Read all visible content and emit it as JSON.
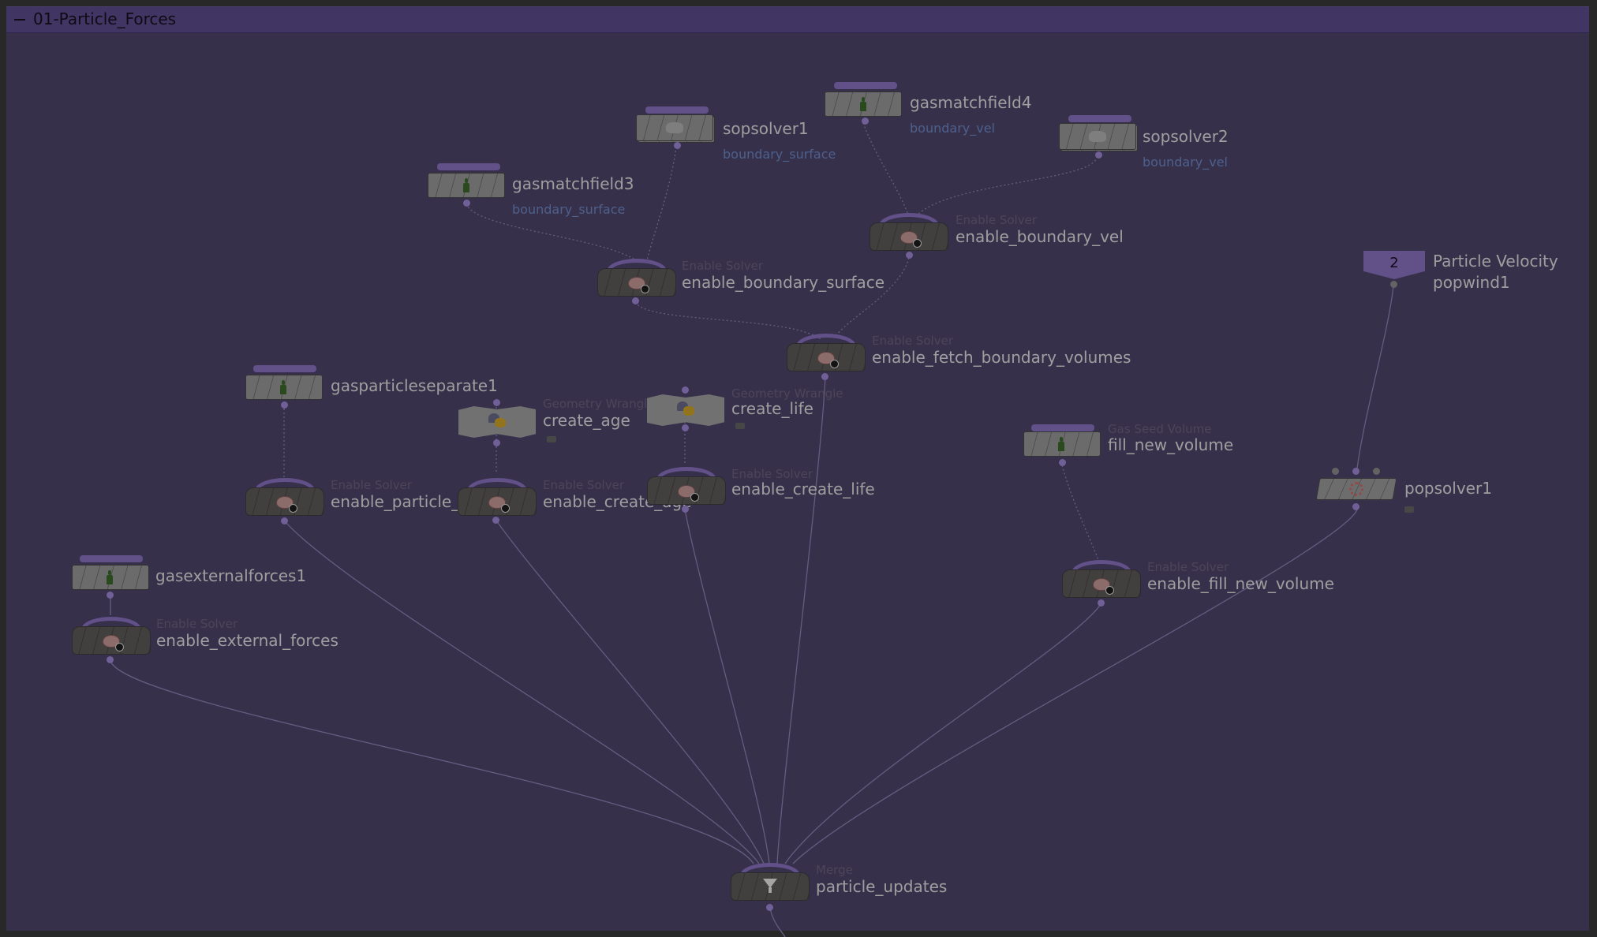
{
  "network_box": {
    "title": "01-Particle_Forces"
  },
  "colors": {
    "background": "#4f456c",
    "title_bar": "#5e4c90",
    "node_bar": "#8d73c4",
    "comment": "#6f8ac9"
  },
  "nodes": {
    "sopsolver1": {
      "name": "sopsolver1",
      "comment": "boundary_surface",
      "icon": "cloud-icon"
    },
    "gasmatchfield4": {
      "name": "gasmatchfield4",
      "comment": "boundary_vel",
      "icon": "figure-icon"
    },
    "sopsolver2": {
      "name": "sopsolver2",
      "comment": "boundary_vel",
      "icon": "cloud-icon"
    },
    "gasmatchfield3": {
      "name": "gasmatchfield3",
      "comment": "boundary_surface",
      "icon": "figure-icon"
    },
    "enable_boundary_vel": {
      "name": "enable_boundary_vel",
      "type": "Enable Solver",
      "icon": "brain-icon"
    },
    "enable_boundary_surface": {
      "name": "enable_boundary_surface",
      "type": "Enable Solver",
      "icon": "brain-icon"
    },
    "popwind1": {
      "label": "Particle Velocity",
      "name": "popwind1",
      "value": "2"
    },
    "enable_fetch_boundary_volumes": {
      "name": "enable_fetch_boundary_volumes",
      "type": "Enable Solver",
      "icon": "brain-icon"
    },
    "gasparticleseparate1": {
      "name": "gasparticleseparate1",
      "icon": "figure-icon"
    },
    "create_age": {
      "name": "create_age",
      "type": "Geometry Wrangle",
      "icon": "wrangle-icon"
    },
    "create_life": {
      "name": "create_life",
      "type": "Geometry Wrangle",
      "icon": "wrangle-icon"
    },
    "fill_new_volume": {
      "name": "fill_new_volume",
      "type": "Gas Seed Volume",
      "icon": "figure-icon"
    },
    "popsolver1": {
      "name": "popsolver1",
      "icon": "pop-icon"
    },
    "enable_particle_separate": {
      "name": "enable_particle_separate",
      "type": "Enable Solver",
      "icon": "brain-icon"
    },
    "enable_create_age": {
      "name": "enable_create_age",
      "type": "Enable Solver",
      "icon": "brain-icon"
    },
    "enable_create_life": {
      "name": "enable_create_life",
      "type": "Enable Solver",
      "icon": "brain-icon"
    },
    "gasexternalforces1": {
      "name": "gasexternalforces1",
      "icon": "figure-icon"
    },
    "enable_external_forces": {
      "name": "enable_external_forces",
      "type": "Enable Solver",
      "icon": "brain-icon"
    },
    "enable_fill_new_volume": {
      "name": "enable_fill_new_volume",
      "type": "Enable Solver",
      "icon": "brain-icon"
    },
    "particle_updates": {
      "name": "particle_updates",
      "type": "Merge",
      "icon": "funnel-icon"
    }
  }
}
